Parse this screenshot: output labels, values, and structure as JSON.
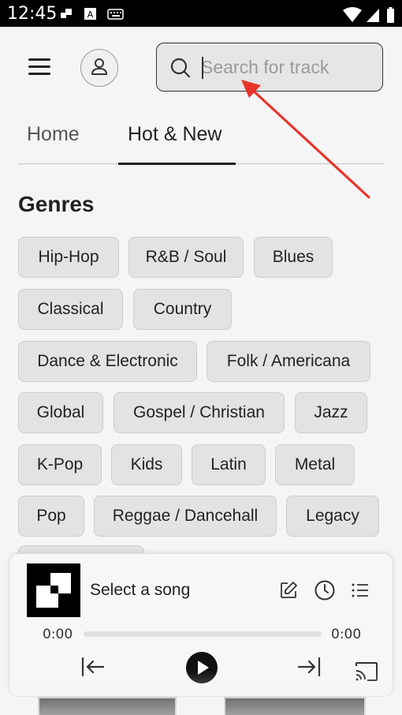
{
  "status_bar": {
    "time": "12:45"
  },
  "search": {
    "placeholder": "Search for track",
    "value": ""
  },
  "tabs": [
    {
      "label": "Home",
      "active": false
    },
    {
      "label": "Hot & New",
      "active": true
    }
  ],
  "genres": {
    "title": "Genres",
    "items": [
      "Hip-Hop",
      "R&B / Soul",
      "Blues",
      "Classical",
      "Country",
      "Dance & Electronic",
      "Folk / Americana",
      "Global",
      "Gospel / Christian",
      "Jazz",
      "K-Pop",
      "Kids",
      "Latin",
      "Metal",
      "Pop",
      "Reggae / Dancehall",
      "Legacy"
    ]
  },
  "player": {
    "song_title": "Select a song",
    "elapsed": "0:00",
    "duration": "0:00",
    "progress": 0
  },
  "icons": [
    "menu-icon",
    "user-icon",
    "search-icon",
    "edit-icon",
    "clock-icon",
    "queue-list-icon",
    "skip-previous-icon",
    "play-icon",
    "skip-next-icon",
    "cast-icon"
  ],
  "colors": {
    "accent": "#222222",
    "annotation_arrow": "#e8352b",
    "chip_bg": "#e3e3e3"
  }
}
